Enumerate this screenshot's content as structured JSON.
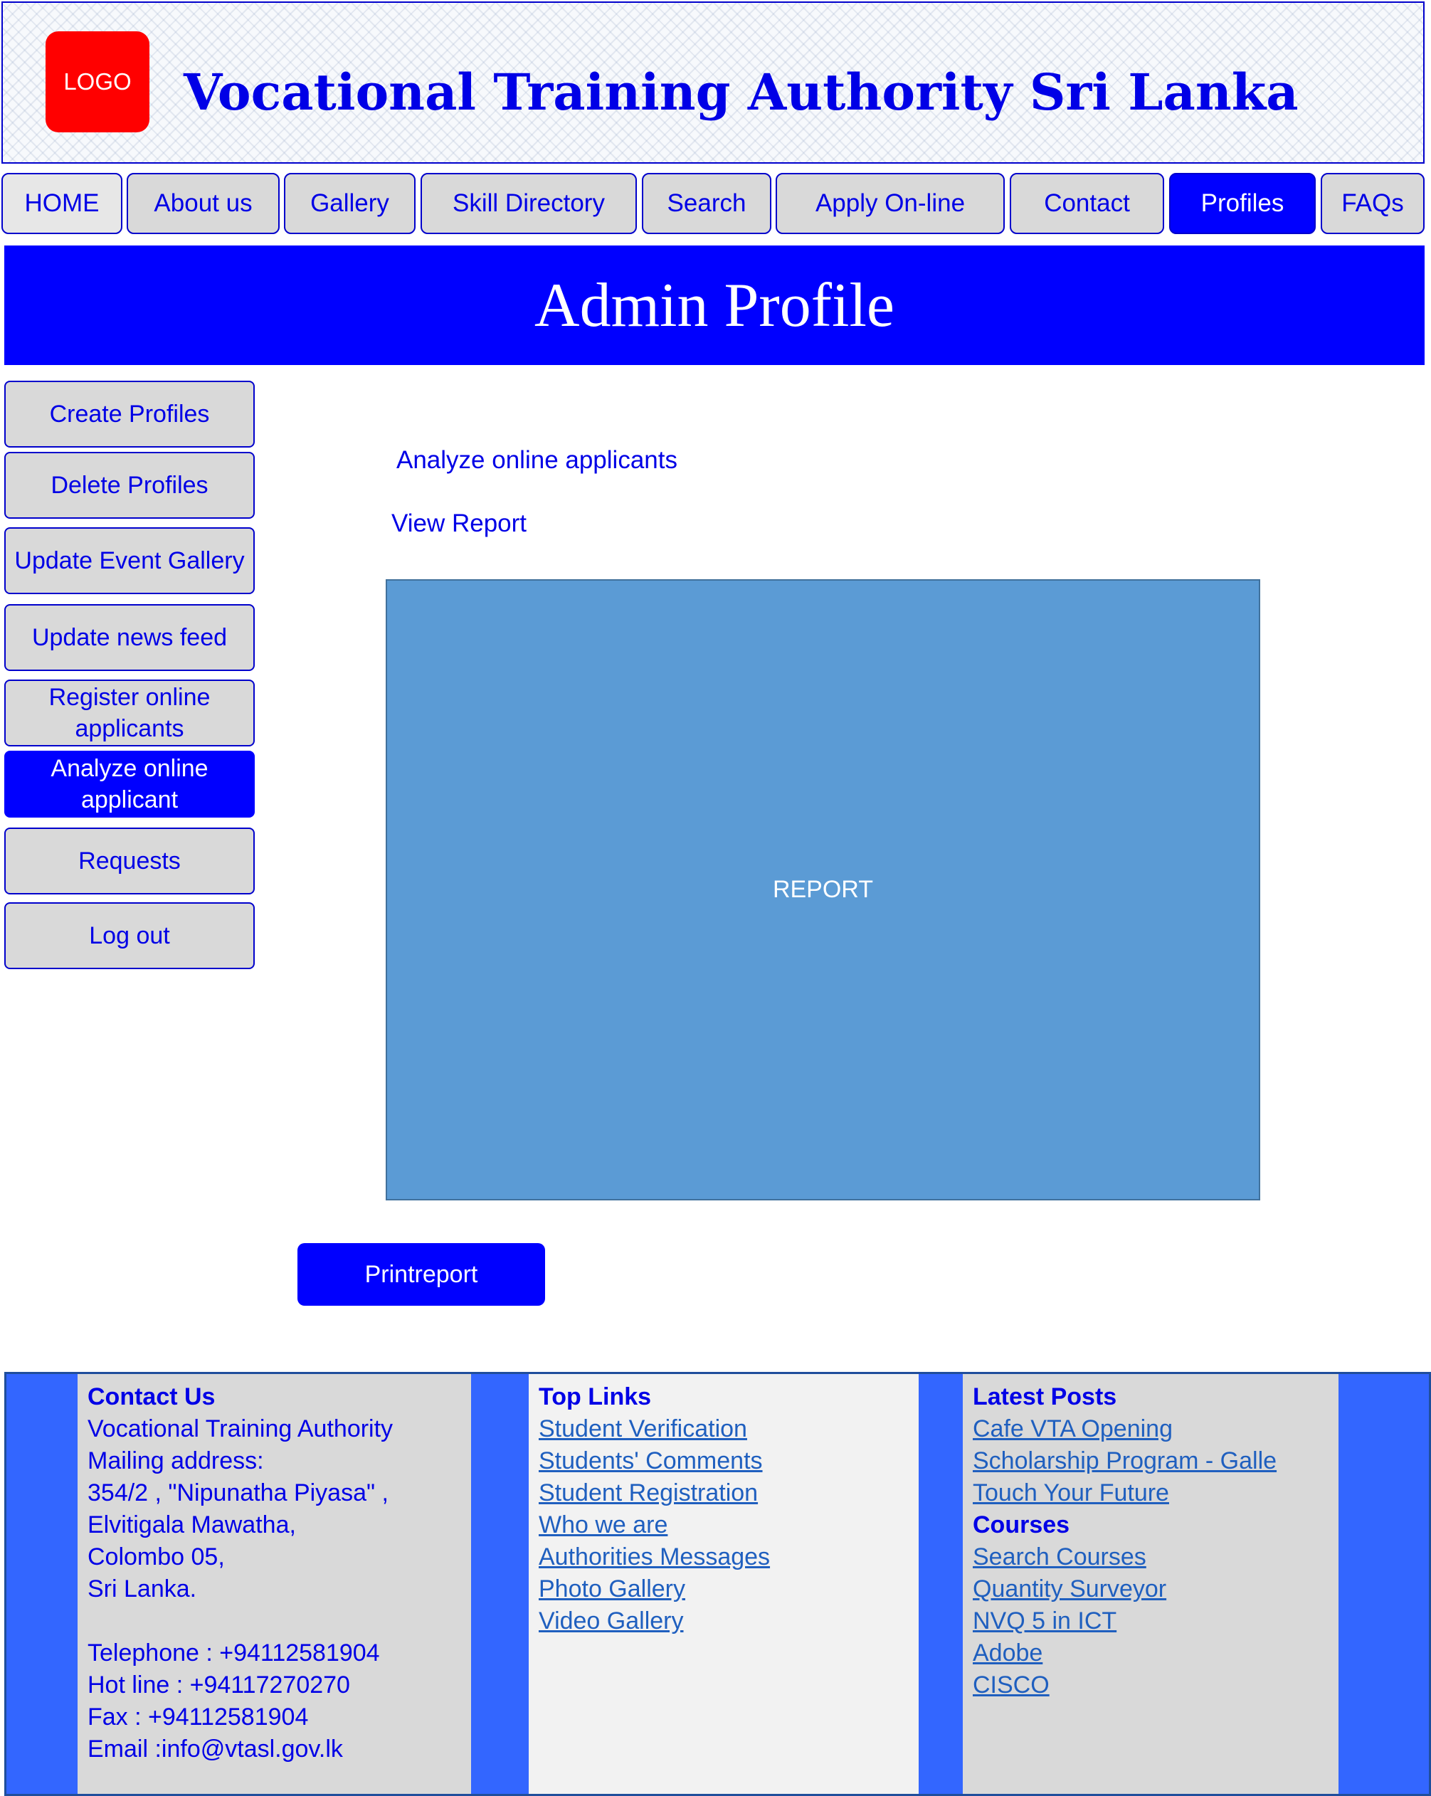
{
  "header": {
    "logo_text": "LOGO",
    "title": "Vocational Training Authority Sri Lanka"
  },
  "nav": {
    "items": [
      {
        "label": "HOME"
      },
      {
        "label": "About us"
      },
      {
        "label": "Gallery"
      },
      {
        "label": "Skill Directory"
      },
      {
        "label": "Search"
      },
      {
        "label": "Apply On-line"
      },
      {
        "label": "Contact"
      },
      {
        "label": "Profiles"
      },
      {
        "label": "FAQs"
      }
    ],
    "active": "Profiles"
  },
  "banner": {
    "title": "Admin Profile"
  },
  "sidebar": {
    "items": [
      {
        "label": "Create Profiles"
      },
      {
        "label": "Delete Profiles"
      },
      {
        "label": "Update Event Gallery"
      },
      {
        "label": "Update news feed"
      },
      {
        "label": "Register online applicants"
      },
      {
        "label": "Analyze online applicant"
      },
      {
        "label": "Requests"
      },
      {
        "label": "Log out"
      }
    ],
    "active": "Analyze online applicant"
  },
  "main": {
    "heading": "Analyze online applicants",
    "view_report": "View Report",
    "report_placeholder": "REPORT",
    "print_button": "Printreport"
  },
  "footer": {
    "contact": {
      "heading": "Contact Us",
      "lines": [
        "Vocational Training Authority",
        "Mailing address:",
        "354/2 , \"Nipunatha Piyasa\" ,",
        "Elvitigala Mawatha,",
        "Colombo 05,",
        "Sri Lanka."
      ],
      "telephone": "Telephone : +94112581904",
      "hotline": "Hot line : +94117270270",
      "fax": "Fax : +94112581904",
      "email": "Email :info@vtasl.gov.lk"
    },
    "top_links": {
      "heading": "Top Links",
      "links": [
        "Student Verification",
        "Students' Comments",
        "Student Registration",
        "Who we are",
        "Authorities Messages",
        "Photo Gallery",
        "Video Gallery"
      ]
    },
    "latest_posts": {
      "heading": "Latest Posts",
      "links": [
        "Cafe VTA Opening",
        "Scholarship Program - Galle",
        "Touch Your Future"
      ]
    },
    "courses": {
      "heading": "Courses",
      "links": [
        "Search Courses",
        "Quantity Surveyor",
        "NVQ 5 in ICT",
        "Adobe",
        "CISCO"
      ]
    }
  },
  "colors": {
    "primary_blue": "#0000ff",
    "text_blue": "#0000e6",
    "button_gray": "#d9d9d9",
    "logo_red": "#ff0000",
    "report_blue": "#5b9bd5",
    "footer_blue": "#3366ff",
    "link_blue": "#1f5fbf"
  }
}
